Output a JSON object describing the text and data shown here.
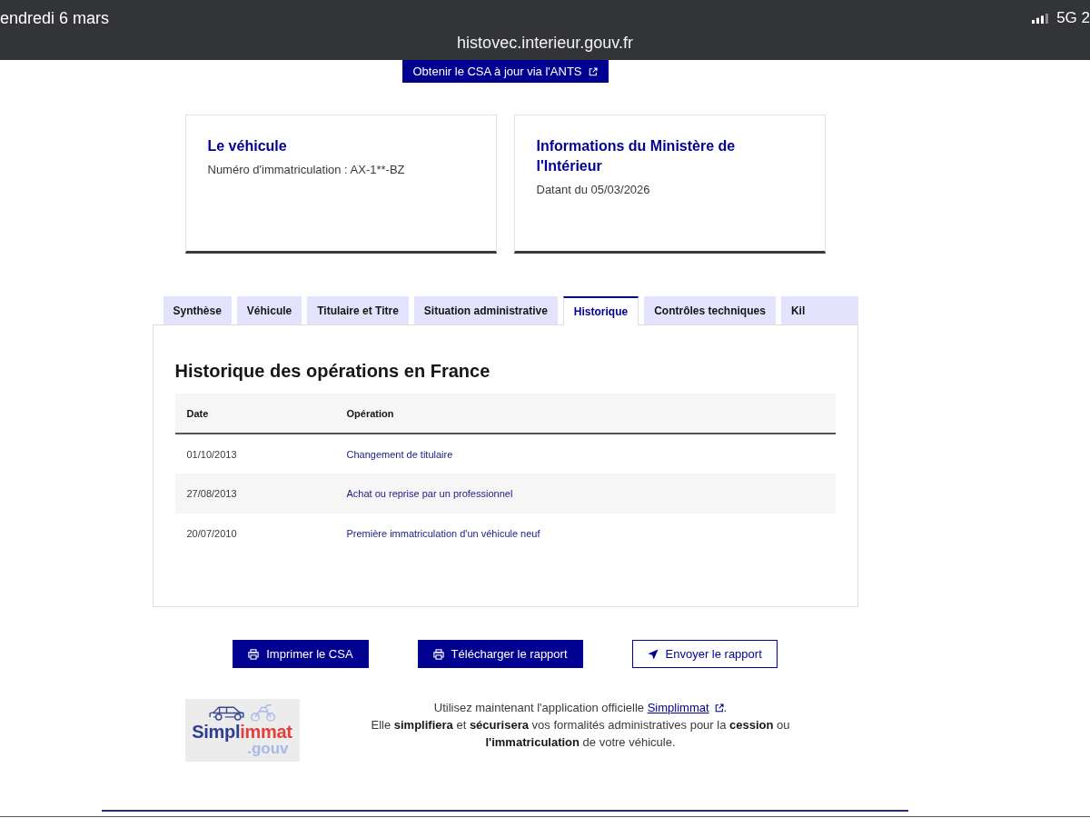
{
  "status_bar": {
    "date": "endredi 6 mars",
    "url": "histovec.interieur.gouv.fr",
    "network": "5G 2"
  },
  "csa_button": {
    "label": "Obtenir le CSA à jour via l'ANTS"
  },
  "cards": [
    {
      "title": "Le véhicule",
      "subtitle": "Numéro d'immatriculation : AX-1**-BZ"
    },
    {
      "title": "Informations du Ministère de l'Intérieur",
      "subtitle": "Datant du 05/03/2026"
    }
  ],
  "tabs": [
    {
      "label": "Synthèse",
      "selected": false
    },
    {
      "label": "Véhicule",
      "selected": false
    },
    {
      "label": "Titulaire et Titre",
      "selected": false
    },
    {
      "label": "Situation administrative",
      "selected": false
    },
    {
      "label": "Historique",
      "selected": true
    },
    {
      "label": "Contrôles techniques",
      "selected": false
    },
    {
      "label": "Kil",
      "selected": false
    }
  ],
  "history": {
    "title": "Historique des opérations en France",
    "columns": [
      "Date",
      "Opération"
    ],
    "rows": [
      [
        "01/10/2013",
        "Changement de titulaire"
      ],
      [
        "27/08/2013",
        "Achat ou reprise par un professionnel"
      ],
      [
        "20/07/2010",
        "Première immatriculation d'un véhicule neuf"
      ]
    ]
  },
  "actions": [
    {
      "label": "Imprimer le CSA",
      "kind": "filled"
    },
    {
      "label": "Télécharger le rapport",
      "kind": "filled"
    },
    {
      "label": "Envoyer le rapport",
      "kind": "outlined"
    }
  ],
  "promo": {
    "logo": {
      "name_start": "Simpl",
      "name_end": "immat",
      "suffix": ".gouv"
    },
    "intro": "Utilisez maintenant l'application officielle",
    "link": "Simplimmat",
    "after": ".",
    "description": "Elle **simplifiera** et **sécurisera** vos formalités administratives pour la **cession** ou **l'immatriculation** de votre véhicule."
  }
}
